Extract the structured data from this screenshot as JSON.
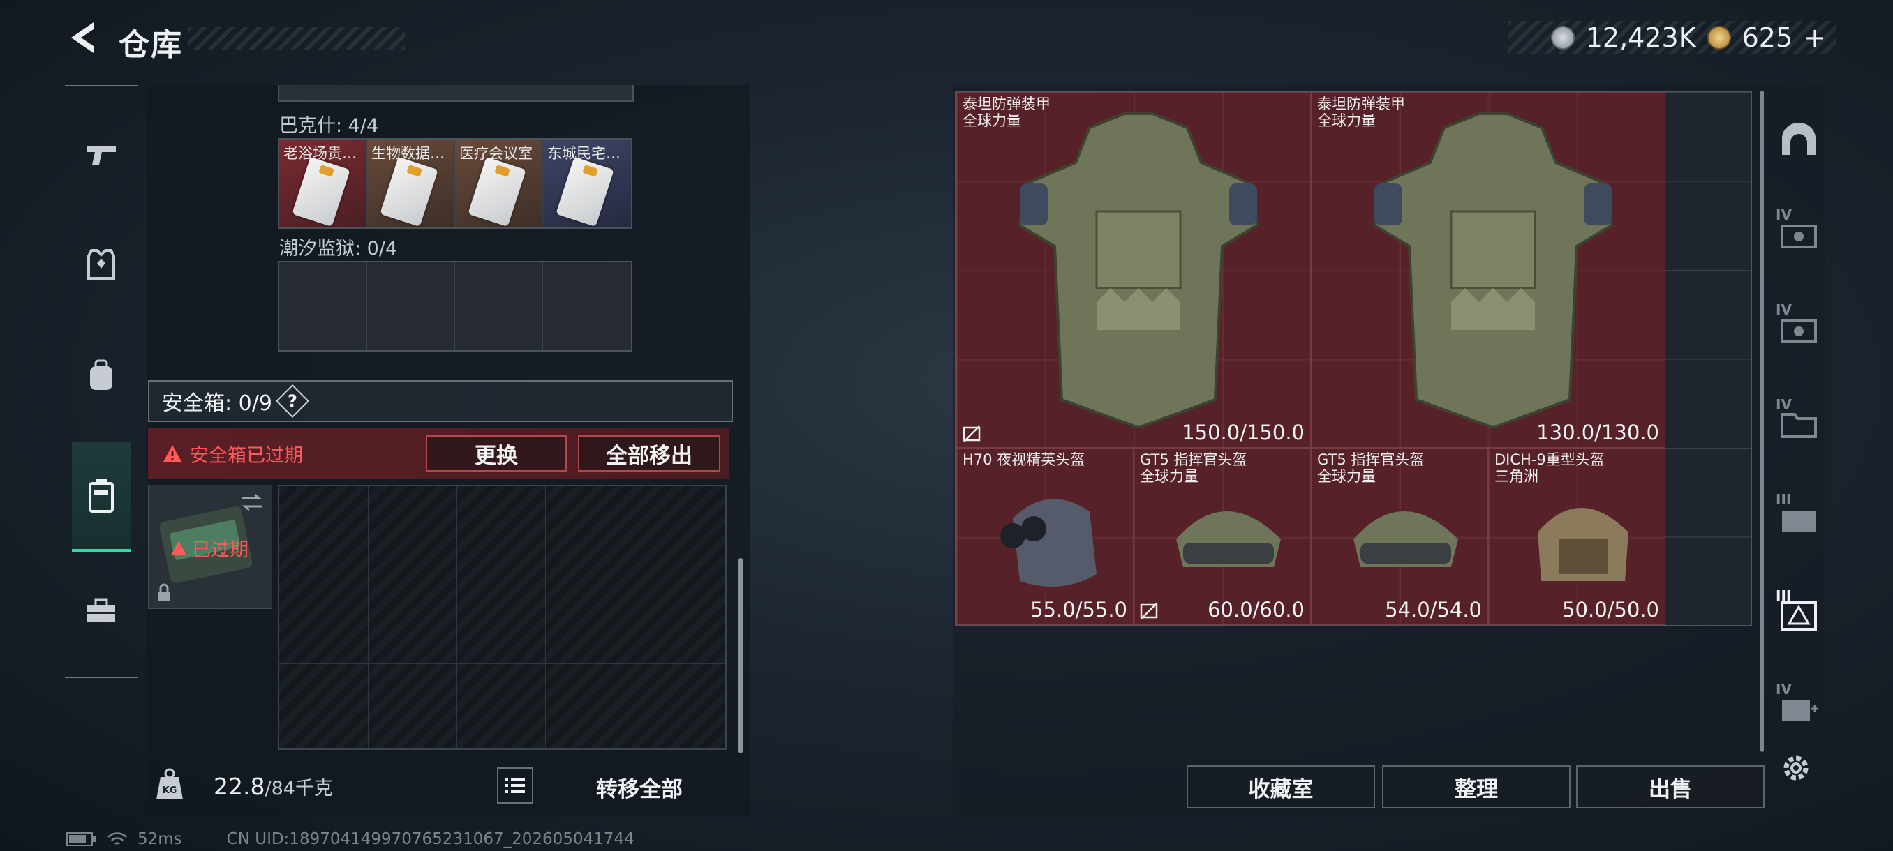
{
  "header": {
    "title": "仓库",
    "currency_primary": "12,423K",
    "currency_secondary": "625",
    "currency_add": "+"
  },
  "left_nav": {
    "items": [
      {
        "icon": "gun-icon"
      },
      {
        "icon": "armor-vest-icon"
      },
      {
        "icon": "backpack-icon"
      },
      {
        "icon": "safe-case-icon",
        "active": true
      },
      {
        "icon": "toolbox-icon"
      }
    ]
  },
  "keys": {
    "group1_label": "巴克什: 4/4",
    "group1_items": [
      "老浴场贵…",
      "生物数据…",
      "医疗会议室",
      "东城民宅…"
    ],
    "group2_label": "潮汐监狱: 0/4"
  },
  "safebox": {
    "label": "安全箱: 0/9",
    "help": "?",
    "expired_warning": "安全箱已过期",
    "replace_button": "更换",
    "remove_all_button": "全部移出",
    "case_status": "已过期"
  },
  "weight": {
    "current": "22.8",
    "max": "/84千克",
    "lock_label": "KG",
    "transfer_all_button": "转移全部"
  },
  "status": {
    "ping": "52ms",
    "uid": "CN UID:1897041499707652310​67_202605041744"
  },
  "stash_items": [
    {
      "name1": "泰坦防弹装甲",
      "name2": "全球力量",
      "durability": "150.0/150.0",
      "no_insure": true
    },
    {
      "name1": "泰坦防弹装甲",
      "name2": "全球力量",
      "durability": "130.0/130.0",
      "no_insure": false
    },
    {
      "name1": "H70 夜视精英头盔",
      "name2": "",
      "durability": "55.0/55.0",
      "no_insure": false
    },
    {
      "name1": "GT5 指挥官头盔",
      "name2": "全球力量",
      "durability": "60.0/60.0",
      "no_insure": true
    },
    {
      "name1": "GT5 指挥官头盔",
      "name2": "全球力量",
      "durability": "54.0/54.0",
      "no_insure": false
    },
    {
      "name1": "DICH-9重型头盔",
      "name2": "三角洲",
      "durability": "50.0/50.0",
      "no_insure": false
    }
  ],
  "side_tabs": [
    {
      "icon": "arch-icon",
      "level": ""
    },
    {
      "icon": "weapon-case-icon",
      "level": "IV"
    },
    {
      "icon": "weapon-case-icon",
      "level": "IV"
    },
    {
      "icon": "folder-case-icon",
      "level": "IV"
    },
    {
      "icon": "weapon-case-icon",
      "level": "III"
    },
    {
      "icon": "armor-case-icon",
      "level": "III",
      "active": true
    },
    {
      "icon": "add-case-icon",
      "level": "IV"
    }
  ],
  "bottom_buttons": {
    "collection": "收藏室",
    "sort": "整理",
    "sell": "出售"
  },
  "colors": {
    "accent_green": "#3fd1a4",
    "warning_red": "#ff5a5a",
    "item_bg_red": "#6e202a"
  }
}
